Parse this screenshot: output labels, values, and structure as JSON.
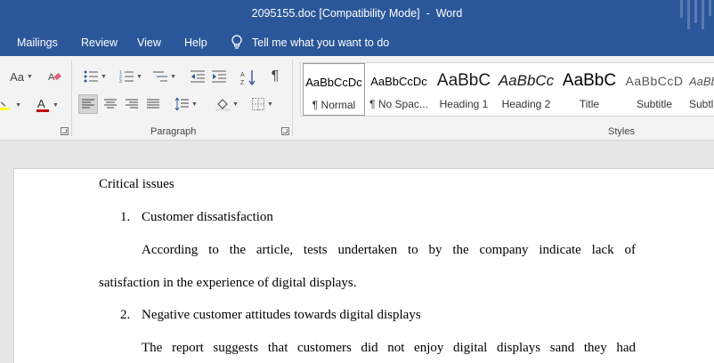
{
  "window": {
    "filename": "2095155.doc [Compatibility Mode]",
    "separator": "-",
    "app": "Word"
  },
  "menu": {
    "items": [
      "Mailings",
      "Review",
      "View",
      "Help"
    ],
    "tell_me": "Tell me what you want to do"
  },
  "ribbon": {
    "font_case_label": "Aa",
    "paragraph_label": "Paragraph",
    "styles_label": "Styles",
    "styles": [
      {
        "sample": "AaBbCcDc",
        "name": "¶ Normal"
      },
      {
        "sample": "AaBbCcDc",
        "name": "¶ No Spac..."
      },
      {
        "sample": "AaBbC",
        "name": "Heading 1"
      },
      {
        "sample": "AaBbCc",
        "name": "Heading 2"
      },
      {
        "sample": "AaBbC",
        "name": "Title"
      },
      {
        "sample": "AaBbCcD",
        "name": "Subtitle"
      },
      {
        "sample": "AaBb",
        "name": "Subtl"
      }
    ]
  },
  "document": {
    "heading": "Critical issues",
    "item1_number": "1.",
    "item1_text": "Customer dissatisfaction",
    "para1_line1": "According to the article, tests undertaken to by the company indicate lack of",
    "para1_line2": "satisfaction in the experience of digital displays.",
    "item2_number": "2.",
    "item2_text": "Negative customer attitudes towards digital displays",
    "para2_line1": "The report suggests that customers did not enjoy digital displays sand they had"
  },
  "colors": {
    "titlebar": "#2b579a",
    "ribbon": "#f3f3f3",
    "highlight": "#ffff00",
    "font_color": "#c00000"
  }
}
